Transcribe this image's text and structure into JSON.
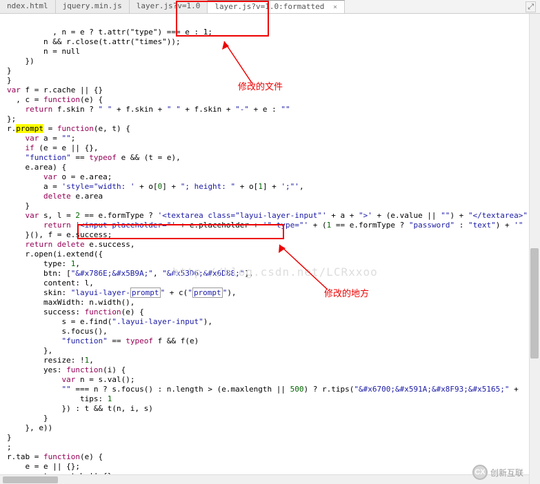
{
  "tabs": [
    {
      "label": "ndex.html"
    },
    {
      "label": "jquery.min.js"
    },
    {
      "label": "layer.js?v=1.0"
    },
    {
      "label": "layer.js?v=1.0:formatted",
      "active": true,
      "close": "×"
    }
  ],
  "corner_icon": "⤢",
  "annotations": {
    "file_label": "修改的文件",
    "place_label": "修改的地方"
  },
  "watermark": "http://blog.csdn.net/LCRxxoo",
  "logo": {
    "text": "创新互联",
    "badge": "CX"
  },
  "code": {
    "l1": "          , n = e ? t.attr(\"type\") === e : 1;",
    "l2": "        n && r.close(t.attr(\"times\"));",
    "l3": "        n = null",
    "l4": "    })",
    "l5": "}",
    "l6": "}",
    "l7_a": "var",
    "l7_b": " f = r.cache || {}",
    "l8_a": "  , c = ",
    "l8_kw": "function",
    "l8_b": "(e) {",
    "l9_a": "    return",
    "l9_b": " f.skin ? ",
    "l9_s1": "\" \"",
    "l9_c": " + f.skin + ",
    "l9_s2": "\" \"",
    "l9_d": " + f.skin + ",
    "l9_s3": "\"-\"",
    "l9_e": " + e : ",
    "l9_s4": "\"\"",
    "l10": "};",
    "l11_a": "r.",
    "l11_hl": "prompt",
    "l11_b": " = ",
    "l11_kw": "function",
    "l11_c": "(e, t) {",
    "l12_a": "    var",
    "l12_b": " a = ",
    "l12_s": "\"\"",
    "l12_c": ";",
    "l13_a": "    if",
    "l13_b": " (e = e || {},",
    "l14_a": "    ",
    "l14_s": "\"function\"",
    "l14_b": " == ",
    "l14_kw": "typeof",
    "l14_c": " e && (t = e),",
    "l15": "    e.area) {",
    "l16_a": "        var",
    "l16_b": " o = e.area;",
    "l17_a": "        a = ",
    "l17_s1": "'style=\"width: '",
    "l17_b": " + o[",
    "l17_n1": "0",
    "l17_c": "] + ",
    "l17_s2": "\"; height: \"",
    "l17_d": " + o[",
    "l17_n2": "1",
    "l17_e": "] + ",
    "l17_s3": "';\"'",
    "l17_f": ",",
    "l18_a": "        delete",
    "l18_b": " e.area",
    "l19": "    }",
    "l20_a": "    var",
    "l20_b": " s, l = ",
    "l20_n": "2",
    "l20_c": " == e.formType ? ",
    "l20_s1": "'<textarea class=\"layui-layer-input\"'",
    "l20_d": " + a + ",
    "l20_s2": "\">'",
    "l20_e": " + (e.value || ",
    "l20_s3": "\"\"",
    "l20_f": ") + ",
    "l20_s4": "\"</textarea>\"",
    "l21_a": "        return",
    "l21_s1": " '<input",
    "l21_s2": " placeholder=\"'",
    "l21_b": " + e.placeholder + ",
    "l21_s3": "'\"",
    "l21_c": " type=\"'",
    "l21_d": " + (",
    "l21_n": "1",
    "l21_e": " == e.formType ? ",
    "l21_s4": "\"password\"",
    "l21_f": " : ",
    "l21_s5": "\"text\"",
    "l21_g": ") + ",
    "l21_s6": "'\"",
    "l22": "    }(), f = e.success;",
    "l23_a": "    return",
    "l23_b": " ",
    "l23_kw": "delete",
    "l23_c": " e.success,",
    "l24": "    r.open(i.extend({",
    "l25_a": "        type: ",
    "l25_n": "1",
    "l25_b": ",",
    "l26_a": "        btn: [",
    "l26_s1": "\"&#x786E;&#x5B9A;\"",
    "l26_b": ", ",
    "l26_s2": "\"&#x53D6;&#x6D88;\"",
    "l26_c": "],",
    "l27": "        content: l,",
    "l28_a": "        skin: ",
    "l28_s": "\"layui-layer-",
    "l28_p1": "prompt",
    "l28_s2": "\"",
    "l28_b": " + c(",
    "l28_s3": "\"",
    "l28_p2": "prompt",
    "l28_s4": "\"",
    "l28_c": "),",
    "l29": "        maxWidth: n.width(),",
    "l30_a": "        success: ",
    "l30_kw": "function",
    "l30_b": "(e) {",
    "l31_a": "            s = e.find(",
    "l31_s": "\".layui-layer-input\"",
    "l31_b": "),",
    "l32": "            s.focus(),",
    "l33_a": "            ",
    "l33_s": "\"function\"",
    "l33_b": " == ",
    "l33_kw": "typeof",
    "l33_c": " f && f(e)",
    "l34": "        },",
    "l35_a": "        resize: !",
    "l35_n": "1",
    "l35_b": ",",
    "l36_a": "        yes: ",
    "l36_kw": "function",
    "l36_b": "(i) {",
    "l37_a": "            var",
    "l37_b": " n = s.val();",
    "l38_a": "            ",
    "l38_s1": "\"\"",
    "l38_b": " === n ? s.focus() : n.length > (e.maxlength || ",
    "l38_n": "500",
    "l38_c": ") ? r.tips(",
    "l38_s2": "\"&#x6700;&#x591A;&#x8F93;&#x5165;\"",
    "l38_d": " + ",
    "l39_a": "                tips: ",
    "l39_n": "1",
    "l40": "            }) : t && t(n, i, s)",
    "l41": "        }",
    "l42": "    }, e))",
    "l43": "}",
    "l44": ";",
    "l45_a": "r.tab = ",
    "l45_kw": "function",
    "l45_b": "(e) {",
    "l46": "    e = e || {};",
    "l47_a": "    var",
    "l47_b": " t = e.tab || {}"
  }
}
